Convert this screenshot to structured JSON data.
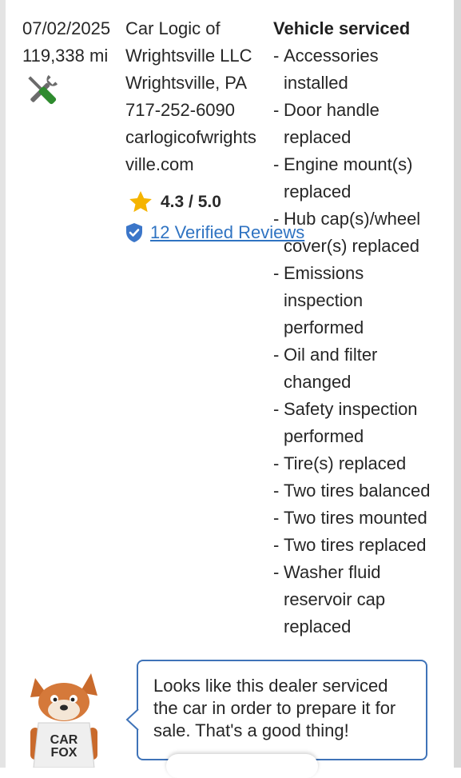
{
  "record": {
    "date": "07/02/2025",
    "mileage": "119,338 mi",
    "icon": "tools-icon"
  },
  "dealer": {
    "name_line1": "Car Logic of",
    "name_line2": "Wrightsville LLC",
    "location": "Wrightsville, PA",
    "phone": "717-252-6090",
    "website_line1": "carlogicofwrights",
    "website_line2": "ville.com",
    "rating": "4.3 / 5.0",
    "reviews_link": "12 Verified Reviews"
  },
  "services": {
    "heading": "Vehicle serviced",
    "items": [
      {
        "dash": "-",
        "lines": [
          "Accessories",
          "installed"
        ]
      },
      {
        "dash": "-",
        "lines": [
          "Door handle",
          "replaced"
        ]
      },
      {
        "dash": "-",
        "lines": [
          "Engine mount(s)",
          "replaced"
        ]
      },
      {
        "dash": "-",
        "lines": [
          "Hub cap(s)/wheel",
          "cover(s) replaced"
        ]
      },
      {
        "dash": "-",
        "lines": [
          "Emissions",
          "inspection",
          "performed"
        ]
      },
      {
        "dash": "-",
        "lines": [
          "Oil and filter",
          "changed"
        ]
      },
      {
        "dash": "-",
        "lines": [
          "Safety inspection",
          "performed"
        ]
      },
      {
        "dash": "-",
        "lines": [
          "Tire(s) replaced"
        ]
      },
      {
        "dash": "-",
        "lines": [
          "Two tires balanced"
        ]
      },
      {
        "dash": "-",
        "lines": [
          "Two tires mounted"
        ]
      },
      {
        "dash": "-",
        "lines": [
          "Two tires replaced"
        ]
      },
      {
        "dash": "-",
        "lines": [
          "Washer fluid",
          "reservoir cap",
          "replaced"
        ]
      }
    ]
  },
  "mascot": {
    "shirt_line1": "CAR",
    "shirt_line2": "FOX"
  },
  "callout": {
    "text": "Looks like this dealer serviced the car in order to prepare it for sale. That's a good thing!"
  },
  "colors": {
    "link": "#2f73c2",
    "star": "#f5b400",
    "tool_green": "#2e8b2e",
    "bubble_border": "#3f73b8"
  }
}
